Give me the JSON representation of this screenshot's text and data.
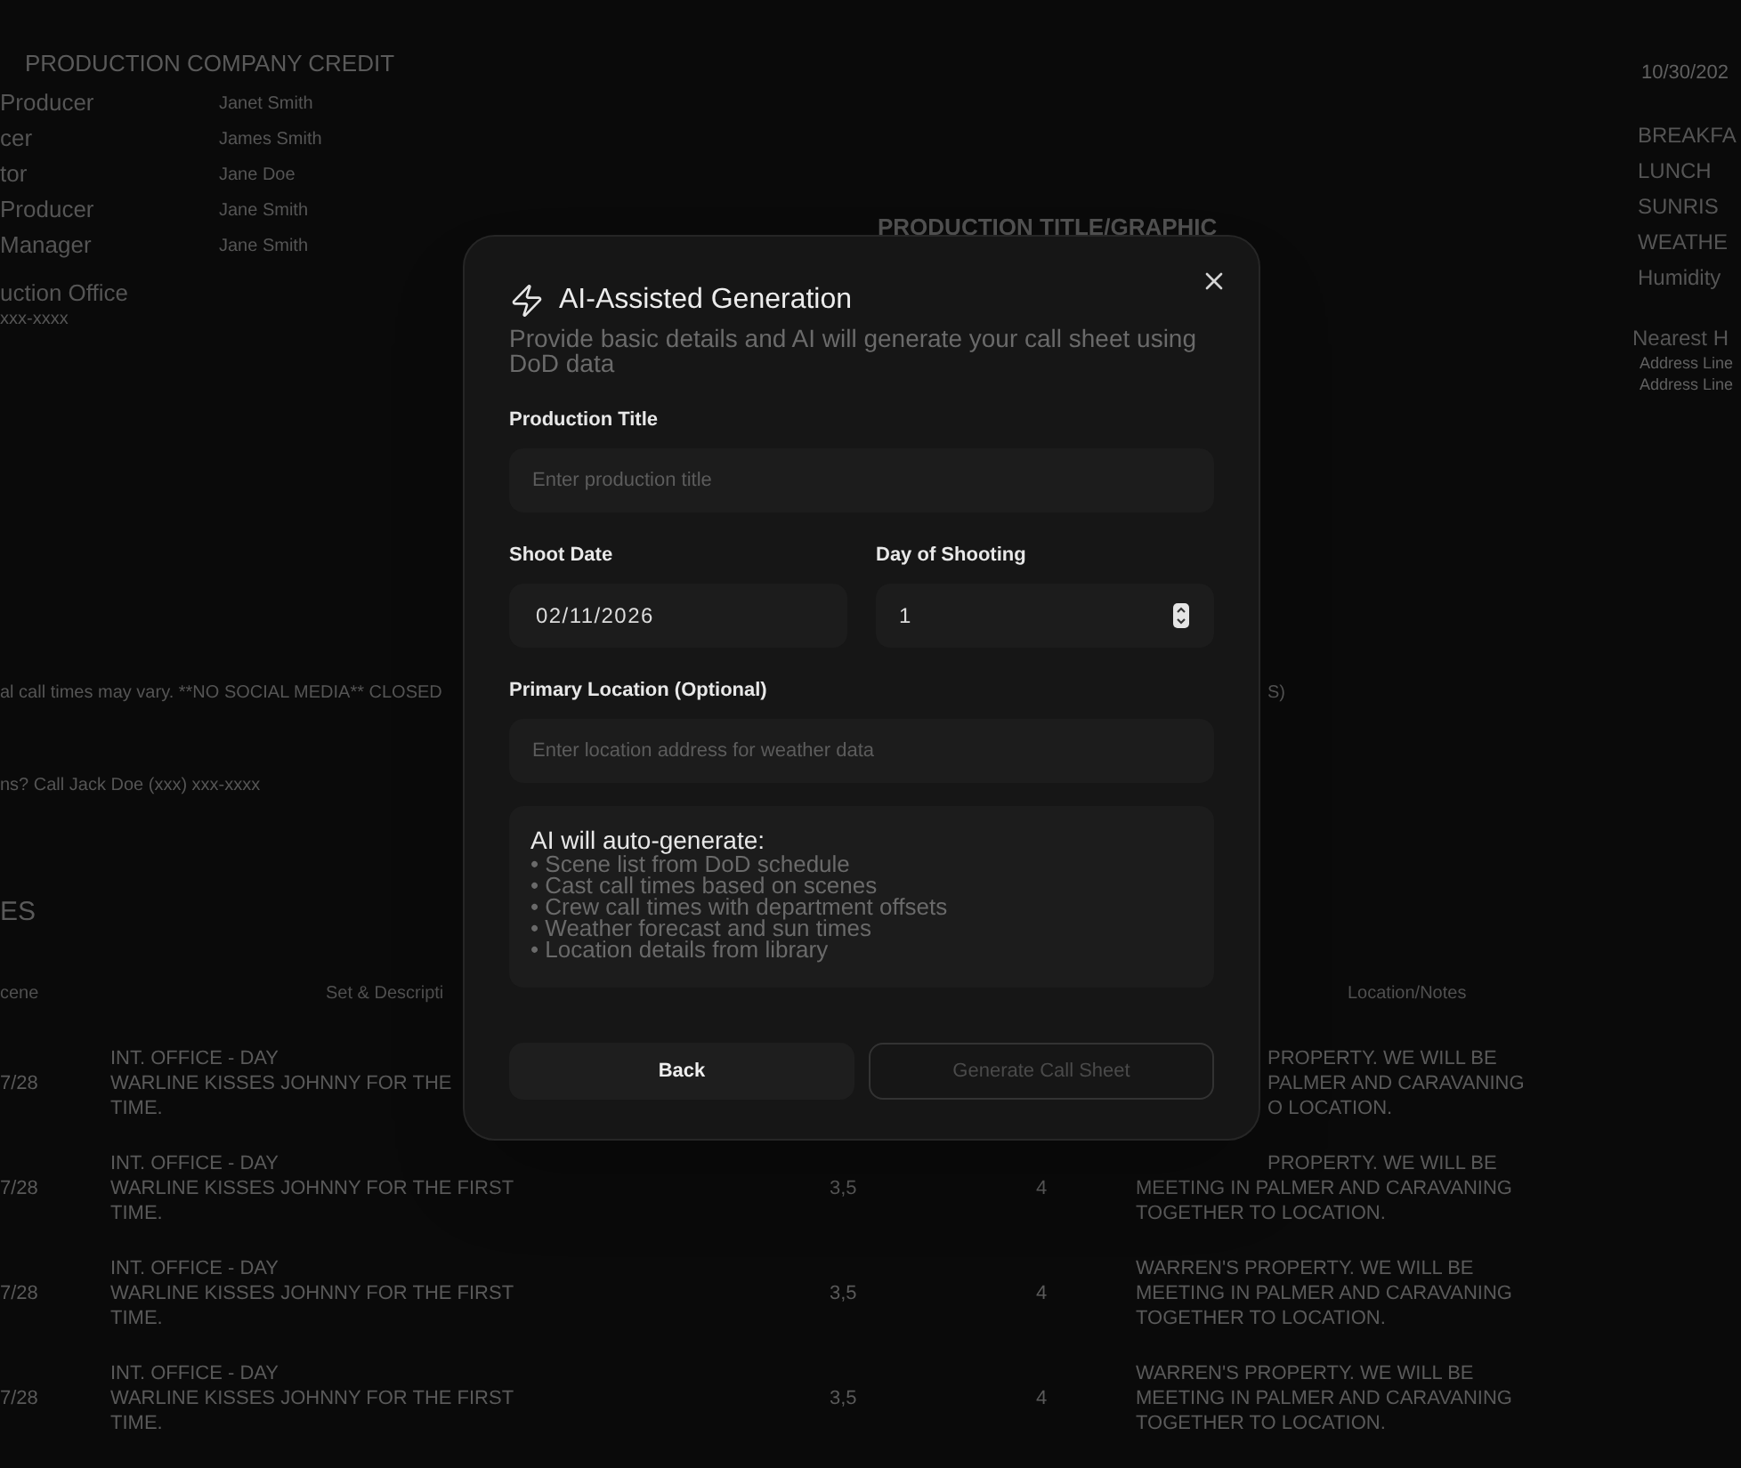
{
  "background": {
    "credits": {
      "heading": "PRODUCTION COMPANY CREDIT",
      "rows": [
        {
          "role": "Producer",
          "name": "Janet Smith"
        },
        {
          "role": "cer",
          "name": "James Smith"
        },
        {
          "role": "tor",
          "name": "Jane Doe"
        },
        {
          "role": "Producer",
          "name": "Jane Smith"
        },
        {
          "role": "Manager",
          "name": "Jane Smith"
        }
      ],
      "office": "uction Office",
      "phone": "xxx-xxxx"
    },
    "title_graphic": "PRODUCTION TITLE/GRAPHIC",
    "summary": {
      "date": "10/30/202",
      "items": [
        "BREAKFA",
        "LUNCH",
        "SUNRIS",
        "WEATHE",
        "Humidity"
      ],
      "hospital": "Nearest H",
      "address_lines": [
        "Address Line",
        "Address Line"
      ]
    },
    "notes": [
      {
        "left": "al call times may vary. **NO SOCIAL MEDIA** CLOSED",
        "right": "S)"
      },
      {
        "left": "ns? Call Jack Doe (xxx) xxx-xxxx"
      }
    ],
    "schedule": {
      "heading": "ES",
      "columns": [
        "cene",
        "Set & Descripti",
        "Location/Notes"
      ],
      "rows": [
        {
          "scene": "7/28",
          "set": [
            "INT. OFFICE - DAY",
            "WARLINE KISSES JOHNNY FOR THE",
            "TIME."
          ],
          "notes_tail": [
            "PROPERTY. WE WILL BE",
            "PALMER AND CARAVANING",
            "O LOCATION."
          ]
        },
        {
          "scene": "7/28",
          "set": [
            "INT. OFFICE - DAY",
            "WARLINE KISSES JOHNNY FOR THE FIRST",
            "TIME."
          ],
          "cast": "3,5",
          "pages": "4",
          "notes_tail": [
            "PROPERTY. WE WILL BE"
          ],
          "notes": [
            "MEETING IN PALMER AND CARAVANING",
            "TOGETHER TO LOCATION."
          ]
        },
        {
          "scene": "7/28",
          "set": [
            "INT. OFFICE - DAY",
            "WARLINE KISSES JOHNNY FOR THE FIRST",
            "TIME."
          ],
          "cast": "3,5",
          "pages": "4",
          "notes": [
            "WARREN'S PROPERTY. WE WILL BE",
            "MEETING IN PALMER AND CARAVANING",
            "TOGETHER TO LOCATION."
          ]
        },
        {
          "scene": "7/28",
          "set": [
            "INT. OFFICE - DAY",
            "WARLINE KISSES JOHNNY FOR THE FIRST",
            "TIME."
          ],
          "cast": "3,5",
          "pages": "4",
          "notes": [
            "WARREN'S PROPERTY. WE WILL BE",
            "MEETING IN PALMER AND CARAVANING",
            "TOGETHER TO LOCATION."
          ]
        }
      ]
    }
  },
  "dialog": {
    "title": "AI-Assisted Generation",
    "description": "Provide basic details and AI will generate your call sheet using DoD data",
    "fields": [
      {
        "kind": "text",
        "label": "Production Title",
        "placeholder": "Enter production title"
      },
      {
        "kind": "date",
        "label": "Shoot Date",
        "value": "02/11/2026"
      },
      {
        "kind": "number",
        "label": "Day of Shooting",
        "value": "1"
      },
      {
        "kind": "text",
        "label": "Primary Location (Optional)",
        "placeholder": "Enter location address for weather data"
      }
    ],
    "info": {
      "heading": "AI will auto-generate:",
      "items": [
        "• Scene list from DoD schedule",
        "• Cast call times based on scenes",
        "• Crew call times with department offsets",
        "• Weather forecast and sun times",
        "• Location details from library"
      ]
    },
    "buttons": [
      {
        "label": "Back",
        "disabled": false
      },
      {
        "label": "Generate Call Sheet",
        "disabled": true
      }
    ]
  }
}
